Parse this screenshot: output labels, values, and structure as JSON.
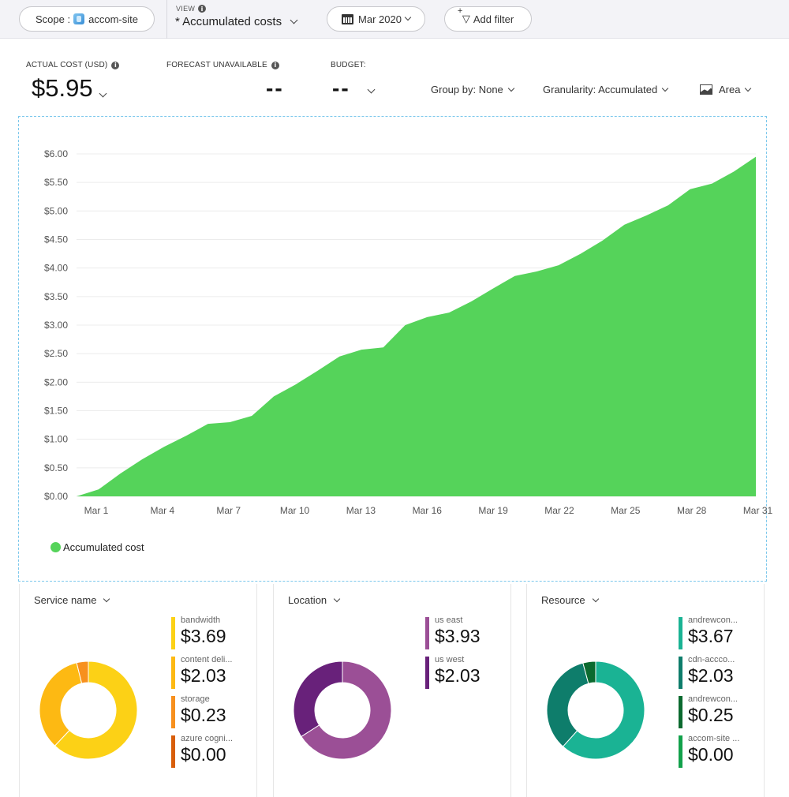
{
  "toolbar": {
    "scope_label": "Scope :",
    "scope_value": "accom-site",
    "view_caption": "VIEW",
    "view_value": "* Accumulated costs",
    "date_range": "Mar 2020",
    "add_filter": "Add filter"
  },
  "kpis": {
    "actual_label": "ACTUAL COST (USD)",
    "actual_value": "$5.95",
    "forecast_label": "FORECAST UNAVAILABLE",
    "forecast_value": "--",
    "budget_label": "BUDGET:",
    "budget_value": "--"
  },
  "chart_options": {
    "group_by": "Group by: None",
    "granularity": "Granularity: Accumulated",
    "chart_type": "Area"
  },
  "chart_data": {
    "type": "area",
    "title": "",
    "xlabel": "",
    "ylabel": "",
    "ylim": [
      0,
      6
    ],
    "yticks": [
      "$0.00",
      "$0.50",
      "$1.00",
      "$1.50",
      "$2.00",
      "$2.50",
      "$3.00",
      "$3.50",
      "$4.00",
      "$4.50",
      "$5.00",
      "$5.50",
      "$6.00"
    ],
    "ytick_values": [
      0,
      0.5,
      1,
      1.5,
      2,
      2.5,
      3,
      3.5,
      4,
      4.5,
      5,
      5.5,
      6
    ],
    "xtick_labels": [
      "Mar 1",
      "Mar 4",
      "Mar 7",
      "Mar 10",
      "Mar 13",
      "Mar 16",
      "Mar 19",
      "Mar 22",
      "Mar 25",
      "Mar 28",
      "Mar 31"
    ],
    "xtick_days": [
      1,
      4,
      7,
      10,
      13,
      16,
      19,
      22,
      25,
      28,
      31
    ],
    "grid": true,
    "legend_position": "bottom-left",
    "series": [
      {
        "name": "Accumulated cost",
        "color": "#55d35a",
        "x": [
          0.1,
          1,
          2,
          3,
          4,
          5,
          6,
          7,
          8,
          9,
          10,
          11,
          12,
          13,
          14,
          15,
          16,
          17,
          18,
          19,
          20,
          21,
          22,
          23,
          24,
          25,
          26,
          27,
          28,
          29,
          30,
          31
        ],
        "values": [
          0.0,
          0.12,
          0.4,
          0.65,
          0.87,
          1.06,
          1.27,
          1.3,
          1.41,
          1.75,
          1.96,
          2.2,
          2.45,
          2.57,
          2.61,
          3.0,
          3.14,
          3.22,
          3.41,
          3.64,
          3.86,
          3.94,
          4.05,
          4.25,
          4.48,
          4.76,
          4.92,
          5.1,
          5.38,
          5.48,
          5.69,
          5.95
        ]
      }
    ]
  },
  "panels": [
    {
      "title": "Service name",
      "items": [
        {
          "name": "bandwidth",
          "value": "$3.69",
          "amount": 3.69,
          "color": "#fcd116"
        },
        {
          "name": "content deli...",
          "value": "$2.03",
          "amount": 2.03,
          "color": "#fdb913"
        },
        {
          "name": "storage",
          "value": "$0.23",
          "amount": 0.23,
          "color": "#f7901e"
        },
        {
          "name": "azure cogni...",
          "value": "$0.00",
          "amount": 0.0,
          "color": "#d85e0a"
        }
      ]
    },
    {
      "title": "Location",
      "items": [
        {
          "name": "us east",
          "value": "$3.93",
          "amount": 3.93,
          "color": "#9b4f96"
        },
        {
          "name": "us west",
          "value": "$2.03",
          "amount": 2.03,
          "color": "#68217a"
        }
      ]
    },
    {
      "title": "Resource",
      "items": [
        {
          "name": "andrewcon...",
          "value": "$3.67",
          "amount": 3.67,
          "color": "#1ab394"
        },
        {
          "name": "cdn-accco...",
          "value": "$2.03",
          "amount": 2.03,
          "color": "#0e7d6b"
        },
        {
          "name": "andrewcon...",
          "value": "$0.25",
          "amount": 0.25,
          "color": "#0b6a2f"
        },
        {
          "name": "accom-site ...",
          "value": "$0.00",
          "amount": 0.0,
          "color": "#12a14b"
        }
      ]
    }
  ]
}
